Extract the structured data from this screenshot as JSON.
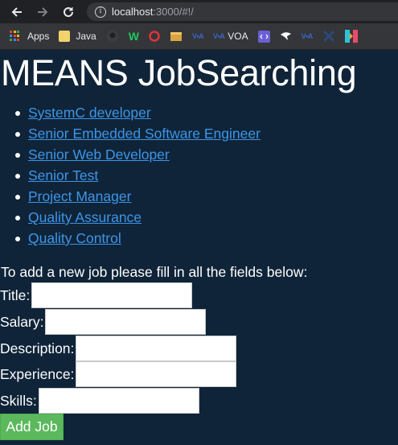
{
  "browser": {
    "url_host": "localhost",
    "url_rest": ":3000/#!/",
    "bookmarks": [
      {
        "label": "Apps",
        "icon": "apps-grid-icon"
      },
      {
        "label": "Java",
        "icon": "folder-icon"
      },
      {
        "label": "",
        "icon": "github-icon"
      },
      {
        "label": "",
        "icon": "w-logo-icon"
      },
      {
        "label": "",
        "icon": "opera-icon"
      },
      {
        "label": "",
        "icon": "box-icon"
      },
      {
        "label": "",
        "icon": "voa-icon"
      },
      {
        "label": "VOA",
        "icon": "voa-icon"
      },
      {
        "label": "",
        "icon": "code-icon"
      },
      {
        "label": "",
        "icon": "bird-icon"
      },
      {
        "label": "",
        "icon": "voa-icon"
      },
      {
        "label": "",
        "icon": "network-icon"
      },
      {
        "label": "",
        "icon": "colorful-logo-icon"
      }
    ]
  },
  "page": {
    "title": "MEANS JobSearching",
    "jobs": [
      "SystemC developer",
      "Senior Embedded Software Engineer",
      "Senior Web Developer",
      "Senior Test",
      "Project Manager",
      "Quality Assurance",
      "Quality Control"
    ],
    "instructions": "To add a new job please fill in all the fields below:",
    "form": {
      "title_label": "Title:",
      "salary_label": "Salary:",
      "description_label": "Description:",
      "experience_label": "Experience:",
      "skills_label": "Skills:",
      "submit_label": "Add Job"
    }
  }
}
